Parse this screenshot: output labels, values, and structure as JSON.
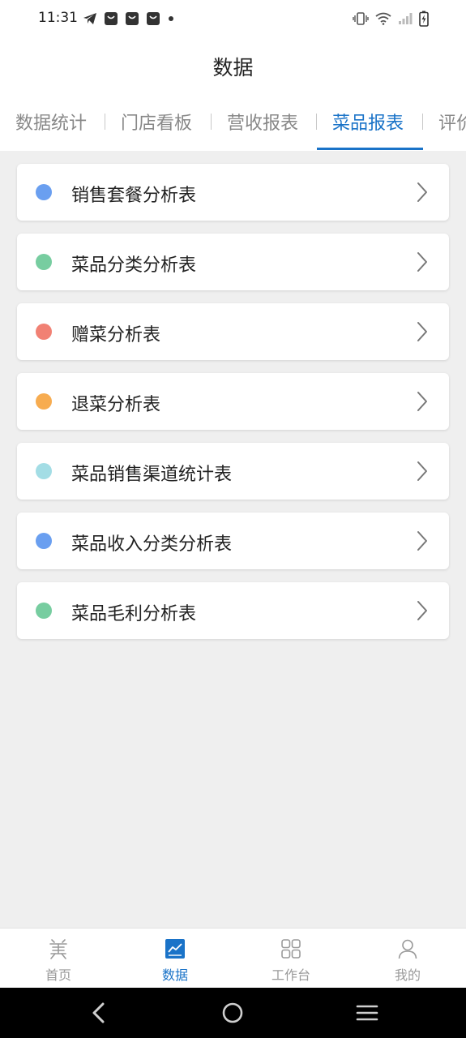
{
  "status_bar": {
    "time": "11:31",
    "left_icons": [
      "telegram-icon",
      "bag-icon",
      "bag-icon",
      "bag-icon",
      "dot-icon"
    ],
    "right_icons": [
      "vibrate-icon",
      "wifi-icon",
      "signal-icon",
      "battery-charging-icon"
    ]
  },
  "header": {
    "title": "数据"
  },
  "tabs": [
    {
      "label": "数据统计",
      "active": false
    },
    {
      "label": "门店看板",
      "active": false
    },
    {
      "label": "营收报表",
      "active": false
    },
    {
      "label": "菜品报表",
      "active": true
    },
    {
      "label": "评价",
      "active": false
    }
  ],
  "report_list": [
    {
      "label": "销售套餐分析表",
      "dot_color": "#6a9ff0"
    },
    {
      "label": "菜品分类分析表",
      "dot_color": "#77cda0"
    },
    {
      "label": "赠菜分析表",
      "dot_color": "#f18174"
    },
    {
      "label": "退菜分析表",
      "dot_color": "#f7ac50"
    },
    {
      "label": "菜品销售渠道统计表",
      "dot_color": "#a3dde5"
    },
    {
      "label": "菜品收入分类分析表",
      "dot_color": "#6a9ff0"
    },
    {
      "label": "菜品毛利分析表",
      "dot_color": "#77cda0"
    }
  ],
  "bottom_nav": [
    {
      "label": "首页",
      "icon": "home-logo-icon",
      "active": false
    },
    {
      "label": "数据",
      "icon": "chart-icon",
      "active": true
    },
    {
      "label": "工作台",
      "icon": "grid-icon",
      "active": false
    },
    {
      "label": "我的",
      "icon": "user-icon",
      "active": false
    }
  ],
  "colors": {
    "accent": "#1a73c8",
    "background": "#efefef"
  }
}
